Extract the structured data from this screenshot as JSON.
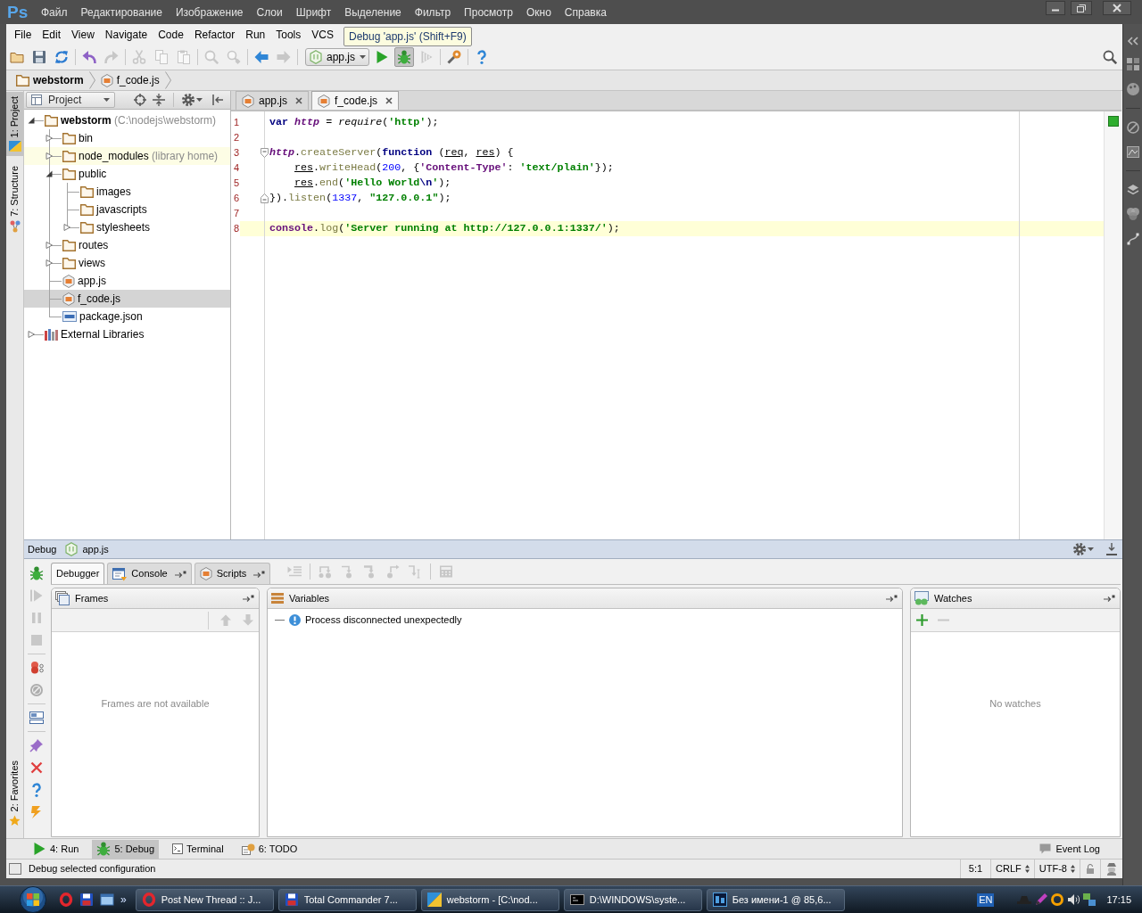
{
  "host_app": {
    "logo": "Ps",
    "menu": [
      "Файл",
      "Редактирование",
      "Изображение",
      "Слои",
      "Шрифт",
      "Выделение",
      "Фильтр",
      "Просмотр",
      "Окно",
      "Справка"
    ]
  },
  "menu_bar": [
    "File",
    "Edit",
    "View",
    "Navigate",
    "Code",
    "Refactor",
    "Run",
    "Tools",
    "VCS"
  ],
  "tooltip": "Debug 'app.js' (Shift+F9)",
  "toolbar": {
    "groups": [
      [
        {
          "kind": "open",
          "disabled": false,
          "pressed": false
        },
        {
          "kind": "save",
          "disabled": false,
          "pressed": false
        },
        {
          "kind": "sync",
          "disabled": false,
          "pressed": false
        }
      ],
      [
        {
          "kind": "undo",
          "disabled": false,
          "pressed": false
        },
        {
          "kind": "redo",
          "disabled": true,
          "pressed": false
        }
      ],
      [
        {
          "kind": "cut",
          "disabled": true,
          "pressed": false
        },
        {
          "kind": "copy",
          "disabled": true,
          "pressed": false
        },
        {
          "kind": "paste",
          "disabled": true,
          "pressed": false
        }
      ],
      [
        {
          "kind": "find",
          "disabled": true,
          "pressed": false
        },
        {
          "kind": "replace",
          "disabled": true,
          "pressed": false
        }
      ],
      [
        {
          "kind": "back",
          "disabled": false,
          "pressed": false
        },
        {
          "kind": "forward",
          "disabled": true,
          "pressed": false
        }
      ],
      [
        {
          "kind": "run-config",
          "label": "app.js",
          "disabled": false,
          "pressed": false
        },
        {
          "kind": "run",
          "disabled": false,
          "pressed": false
        },
        {
          "kind": "debug",
          "disabled": false,
          "pressed": true
        },
        {
          "kind": "coverage",
          "disabled": true,
          "pressed": false
        }
      ],
      [
        {
          "kind": "settings",
          "disabled": false,
          "pressed": false
        }
      ],
      [
        {
          "kind": "help",
          "disabled": false,
          "pressed": false
        }
      ]
    ]
  },
  "breadcrumbs": [
    {
      "label": "webstorm",
      "kind": "root"
    },
    {
      "label": "f_code.js",
      "kind": "js"
    }
  ],
  "side_tabs": [
    {
      "label": "1: Project",
      "kind": "project",
      "selected": true
    },
    {
      "label": "7: Structure",
      "kind": "structure",
      "selected": false
    }
  ],
  "bottom_side_tabs": [
    {
      "label": "2: Favorites",
      "kind": "favorites",
      "selected": false
    }
  ],
  "project_panel": {
    "title": "Project",
    "tree": [
      {
        "label": "webstorm",
        "note": "(C:\\nodejs\\webstorm)",
        "kind": "root",
        "expanded": true,
        "selected": false,
        "children": [
          {
            "label": "bin",
            "kind": "folder",
            "expanded": false,
            "selected": false
          },
          {
            "label": "node_modules",
            "note": "(library home)",
            "kind": "library",
            "expanded": false,
            "selected": false
          },
          {
            "label": "public",
            "kind": "folder",
            "expanded": true,
            "selected": false,
            "children": [
              {
                "label": "images",
                "kind": "folder",
                "selected": false
              },
              {
                "label": "javascripts",
                "kind": "folder",
                "selected": false
              },
              {
                "label": "stylesheets",
                "kind": "folder",
                "expanded": false,
                "selected": false
              }
            ]
          },
          {
            "label": "routes",
            "kind": "folder",
            "expanded": false,
            "selected": false
          },
          {
            "label": "views",
            "kind": "folder",
            "expanded": false,
            "selected": false
          },
          {
            "label": "app.js",
            "kind": "js",
            "selected": false
          },
          {
            "label": "f_code.js",
            "kind": "js",
            "selected": true
          },
          {
            "label": "package.json",
            "kind": "json",
            "selected": false
          }
        ]
      },
      {
        "label": "External Libraries",
        "kind": "libraries",
        "expanded": false,
        "selected": false
      }
    ]
  },
  "editor": {
    "tabs": [
      {
        "label": "app.js",
        "selected": false
      },
      {
        "label": "f_code.js",
        "selected": true
      }
    ],
    "errors": false,
    "lines": [
      {
        "number": "1",
        "kind": "plain",
        "indented": false,
        "current": false,
        "tokens": [
          {
            "kind": "keyword",
            "text": "var "
          },
          {
            "kind": "global",
            "text": "http"
          },
          {
            "kind": "plain",
            "text": " = "
          },
          {
            "kind": "function",
            "text": "require"
          },
          {
            "kind": "plain",
            "text": "("
          },
          {
            "kind": "string",
            "text": "'http'"
          },
          {
            "kind": "plain",
            "text": ");"
          }
        ]
      },
      {
        "number": "2",
        "kind": "plain",
        "current": false
      },
      {
        "number": "3",
        "kind": "fold-start",
        "indented": false,
        "current": false,
        "tokens": [
          {
            "kind": "global",
            "text": "http"
          },
          {
            "kind": "plain",
            "text": "."
          },
          {
            "kind": "method",
            "text": "createServer"
          },
          {
            "kind": "plain",
            "text": "("
          },
          {
            "kind": "keyword",
            "text": "function"
          },
          {
            "kind": "plain",
            "text": " ("
          },
          {
            "kind": "param",
            "text": "req"
          },
          {
            "kind": "plain",
            "text": ", "
          },
          {
            "kind": "param",
            "text": "res"
          },
          {
            "kind": "plain",
            "text": ") {"
          }
        ]
      },
      {
        "number": "4",
        "kind": "plain",
        "indented": true,
        "current": false,
        "tokens": [
          {
            "kind": "param",
            "text": "res"
          },
          {
            "kind": "plain",
            "text": "."
          },
          {
            "kind": "method",
            "text": "writeHead"
          },
          {
            "kind": "plain",
            "text": "("
          },
          {
            "kind": "number",
            "text": "200"
          },
          {
            "kind": "plain",
            "text": ", {"
          },
          {
            "kind": "key",
            "text": "'Content-Type'"
          },
          {
            "kind": "plain",
            "text": ": "
          },
          {
            "kind": "string",
            "text": "'text/plain'"
          },
          {
            "kind": "plain",
            "text": "});"
          }
        ]
      },
      {
        "number": "5",
        "kind": "plain",
        "indented": true,
        "current": false,
        "tokens": [
          {
            "kind": "param",
            "text": "res"
          },
          {
            "kind": "plain",
            "text": "."
          },
          {
            "kind": "method",
            "text": "end"
          },
          {
            "kind": "plain",
            "text": "("
          },
          {
            "kind": "string",
            "text": "'Hello World"
          },
          {
            "kind": "escape",
            "text": "\\n"
          },
          {
            "kind": "string",
            "text": "'"
          },
          {
            "kind": "plain",
            "text": ");"
          }
        ]
      },
      {
        "number": "6",
        "kind": "fold-end",
        "indented": false,
        "current": false,
        "tokens": [
          {
            "kind": "plain",
            "text": "})."
          },
          {
            "kind": "method",
            "text": "listen"
          },
          {
            "kind": "plain",
            "text": "("
          },
          {
            "kind": "number",
            "text": "1337"
          },
          {
            "kind": "plain",
            "text": ", "
          },
          {
            "kind": "string",
            "text": "\"127.0.0.1\""
          },
          {
            "kind": "plain",
            "text": ");"
          }
        ]
      },
      {
        "number": "7",
        "kind": "plain",
        "current": false
      },
      {
        "number": "8",
        "kind": "plain",
        "indented": false,
        "current": true,
        "tokens": [
          {
            "kind": "object",
            "text": "console"
          },
          {
            "kind": "plain",
            "text": "."
          },
          {
            "kind": "method",
            "text": "log"
          },
          {
            "kind": "plain",
            "text": "("
          },
          {
            "kind": "string",
            "text": "'Server running at http://127.0.0.1:1337/'"
          },
          {
            "kind": "plain",
            "text": ");"
          }
        ]
      }
    ]
  },
  "debug": {
    "title": "Debug",
    "configuration": "app.js",
    "actions": {
      "groups": [
        [
          {
            "kind": "debug",
            "disabled": false
          },
          {
            "kind": "resume",
            "disabled": true
          },
          {
            "kind": "pause",
            "disabled": true
          },
          {
            "kind": "stop",
            "disabled": true
          }
        ],
        [
          {
            "kind": "breakpoints",
            "disabled": false
          },
          {
            "kind": "mute",
            "disabled": false
          }
        ],
        [
          {
            "kind": "layout",
            "disabled": false
          }
        ],
        [
          {
            "kind": "pin",
            "disabled": false
          },
          {
            "kind": "close",
            "disabled": false
          },
          {
            "kind": "help",
            "disabled": false
          },
          {
            "kind": "lightning",
            "disabled": false
          }
        ]
      ]
    },
    "tabs": [
      {
        "label": "Debugger",
        "kind": "debugger",
        "selected": true
      },
      {
        "label": "Console",
        "kind": "console",
        "selected": false
      },
      {
        "label": "Scripts",
        "kind": "scripts",
        "selected": false
      }
    ],
    "toolbar": {
      "groups": [
        [
          {
            "kind": "show-exec",
            "disabled": true
          }
        ],
        [
          {
            "kind": "step-over",
            "disabled": true
          },
          {
            "kind": "step-into",
            "disabled": true
          },
          {
            "kind": "force-step-into",
            "disabled": true
          },
          {
            "kind": "step-out",
            "disabled": true
          },
          {
            "kind": "run-to-cursor",
            "disabled": true
          }
        ],
        [
          {
            "kind": "evaluate",
            "disabled": true
          }
        ]
      ]
    },
    "frames": {
      "title": "Frames",
      "toolbar": [
        {
          "kind": "up",
          "disabled": true
        },
        {
          "kind": "down",
          "disabled": true
        }
      ],
      "empty_text": "Frames are not available"
    },
    "variables": {
      "title": "Variables",
      "items": [
        {
          "kind": "info",
          "text": "Process disconnected unexpectedly"
        }
      ]
    },
    "watches": {
      "title": "Watches",
      "toolbar": [
        {
          "kind": "add",
          "disabled": false
        },
        {
          "kind": "remove",
          "disabled": true
        }
      ],
      "empty_text": "No watches"
    }
  },
  "tool_windows": {
    "tabs": [
      {
        "label": "4: Run",
        "kind": "run",
        "selected": false
      },
      {
        "label": "5: Debug",
        "kind": "debug",
        "selected": true
      },
      {
        "label": "Terminal",
        "kind": "terminal",
        "selected": false
      },
      {
        "label": "6: TODO",
        "kind": "todo",
        "selected": false
      }
    ],
    "event_log": "Event Log"
  },
  "status_bar": {
    "message": "Debug selected configuration",
    "position": "5:1",
    "line_separator": "CRLF",
    "encoding": "UTF-8"
  },
  "taskbar": {
    "quick_launch": [
      {
        "kind": "opera"
      },
      {
        "kind": "disk"
      },
      {
        "kind": "window"
      }
    ],
    "more": "»",
    "tasks": [
      {
        "label": "Post New Thread :: J...",
        "kind": "opera"
      },
      {
        "label": "Total Commander 7...",
        "kind": "disk"
      },
      {
        "label": "webstorm - [C:\\nod...",
        "kind": "webstorm"
      },
      {
        "label": "D:\\WINDOWS\\syste...",
        "kind": "console"
      },
      {
        "label": "Без имени-1 @ 85,6...",
        "kind": "photoshop"
      }
    ],
    "language": "EN",
    "clock": "17:15"
  }
}
